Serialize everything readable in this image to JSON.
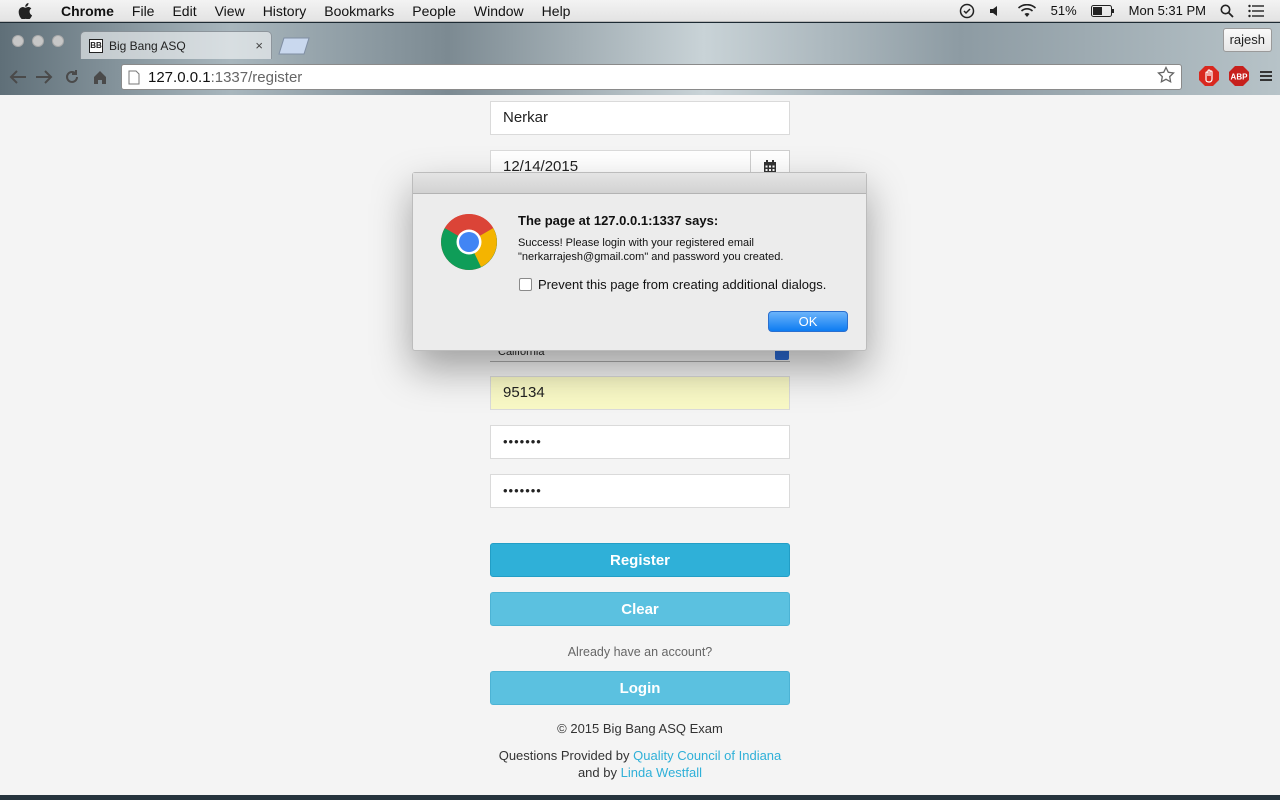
{
  "menubar": {
    "app_name": "Chrome",
    "items": [
      "File",
      "Edit",
      "View",
      "History",
      "Bookmarks",
      "People",
      "Window",
      "Help"
    ],
    "battery": "51%",
    "clock": "Mon 5:31 PM"
  },
  "browser": {
    "tab_title": "Big Bang ASQ",
    "favicon_text": "BB",
    "profile_name": "rajesh",
    "url_host": "127.0.0.1",
    "url_path": ":1337/register"
  },
  "form": {
    "last_name": "Nerkar",
    "date": "12/14/2015",
    "state": "California",
    "zip": "95134",
    "password": "•••••••",
    "confirm_password": "•••••••",
    "register_label": "Register",
    "clear_label": "Clear",
    "already_text": "Already have an account?",
    "login_label": "Login"
  },
  "footer": {
    "copyright": "© 2015 Big Bang ASQ Exam",
    "questions_prefix": "Questions Provided by ",
    "questions_link": "Quality Council of Indiana",
    "and_by": "and by ",
    "author_link": "Linda Westfall"
  },
  "dialog": {
    "heading": "The page at 127.0.0.1:1337 says:",
    "message_line1": "Success! Please login with your registered email",
    "message_line2": "\"nerkarrajesh@gmail.com\" and password you created.",
    "checkbox_label": "Prevent this page from creating additional dialogs.",
    "ok_label": "OK"
  },
  "colors": {
    "primary_button": "#2fb0d8",
    "secondary_button": "#5bc1e0",
    "link": "#2fb0d8",
    "dialog_ok": "#0d7cf2"
  }
}
